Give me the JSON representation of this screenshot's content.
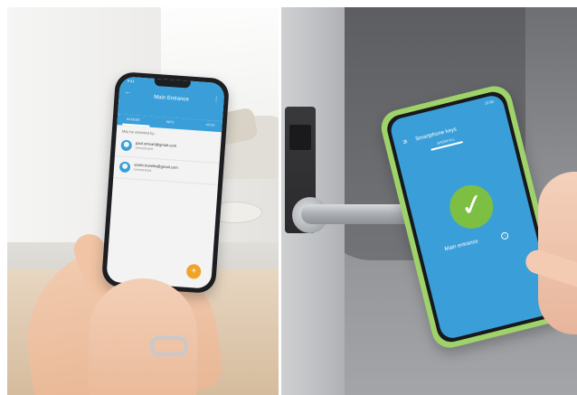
{
  "left_phone": {
    "status_time": "9:41",
    "title": "Main Entrance",
    "tabs": [
      {
        "label": "ACCESS"
      },
      {
        "label": "INFO"
      },
      {
        "label": "ACCE"
      }
    ],
    "section_label": "May be unlocked by:",
    "users": [
      {
        "email": "paul.smeart@gmail.com",
        "status": "Unrestricted"
      },
      {
        "email": "sarah.travello@gmail.com",
        "status": "Unrestricted"
      }
    ],
    "fab_label": "+",
    "colors": {
      "accent": "#3a9fd8",
      "fab": "#f0a324"
    }
  },
  "right_phone": {
    "status_time": "12:30",
    "title": "Smartphone keys",
    "tab": "SHOW ALL",
    "door_label": "Main entrance",
    "info_label": "i",
    "colors": {
      "screen": "#3a9fd8",
      "check": "#7cbf43",
      "case": "#9fd36a"
    }
  },
  "icons": {
    "back": "back-arrow-icon",
    "menu": "more-vert-icon",
    "hamburger": "hamburger-icon",
    "check": "check-icon",
    "user": "user-avatar-icon",
    "info": "info-icon"
  }
}
